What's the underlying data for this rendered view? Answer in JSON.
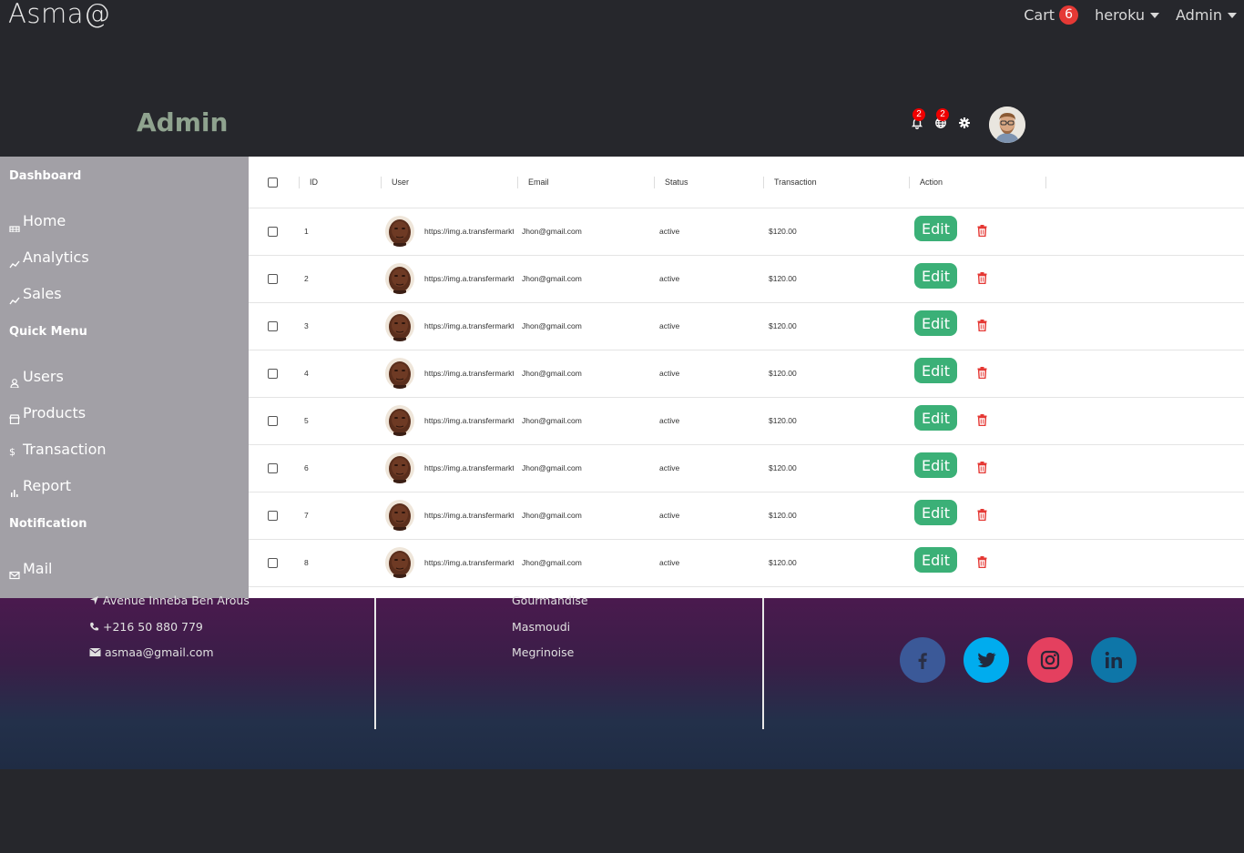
{
  "nav": {
    "brand": "Asma@",
    "cart_label": "Cart",
    "cart_count": "6",
    "heroku_label": "heroku",
    "admin_label": "Admin"
  },
  "header": {
    "title": "Admin",
    "notification_count": "2",
    "language_count": "2"
  },
  "sidebar": {
    "dashboard_title": "Dashboard",
    "home": "Home",
    "analytics": "Analytics",
    "sales": "Sales",
    "quick_menu_title": "Quick Menu",
    "users": "Users",
    "products": "Products",
    "transaction": "Transaction",
    "report": "Report",
    "notification_title": "Notification",
    "mail": "Mail"
  },
  "table": {
    "columns": [
      "ID",
      "User",
      "Email",
      "Status",
      "Transaction",
      "Action"
    ],
    "edit_label": "Edit",
    "rows": [
      {
        "id": "1",
        "user": "https://img.a.transfermarkt",
        "email": "Jhon@gmail.com",
        "status": "active",
        "transaction": "$120.00"
      },
      {
        "id": "2",
        "user": "https://img.a.transfermarkt",
        "email": "Jhon@gmail.com",
        "status": "active",
        "transaction": "$120.00"
      },
      {
        "id": "3",
        "user": "https://img.a.transfermarkt",
        "email": "Jhon@gmail.com",
        "status": "active",
        "transaction": "$120.00"
      },
      {
        "id": "4",
        "user": "https://img.a.transfermarkt",
        "email": "Jhon@gmail.com",
        "status": "active",
        "transaction": "$120.00"
      },
      {
        "id": "5",
        "user": "https://img.a.transfermarkt",
        "email": "Jhon@gmail.com",
        "status": "active",
        "transaction": "$120.00"
      },
      {
        "id": "6",
        "user": "https://img.a.transfermarkt",
        "email": "Jhon@gmail.com",
        "status": "active",
        "transaction": "$120.00"
      },
      {
        "id": "7",
        "user": "https://img.a.transfermarkt",
        "email": "Jhon@gmail.com",
        "status": "active",
        "transaction": "$120.00"
      },
      {
        "id": "8",
        "user": "https://img.a.transfermarkt",
        "email": "Jhon@gmail.com",
        "status": "active",
        "transaction": "$120.00"
      }
    ]
  },
  "footer": {
    "address": "Avenue Inneba Ben Arous",
    "phone": "+216 50 880 779",
    "email": "asmaa@gmail.com",
    "links": [
      "Gourmandise",
      "Masmoudi",
      "Megrinoise"
    ]
  },
  "colors": {
    "accent_green": "#3bb077",
    "badge_red": "#e53935",
    "delete_red": "#e53935",
    "facebook": "#3b5998",
    "twitter": "#00acee",
    "instagram": "#e4405f",
    "linkedin": "#0e76a8"
  },
  "icons": [
    "notification-bell-icon",
    "globe-icon",
    "gear-icon",
    "trash-icon",
    "map-arrow-icon",
    "phone-icon",
    "envelope-icon",
    "facebook-icon",
    "twitter-icon",
    "instagram-icon",
    "linkedin-icon"
  ]
}
